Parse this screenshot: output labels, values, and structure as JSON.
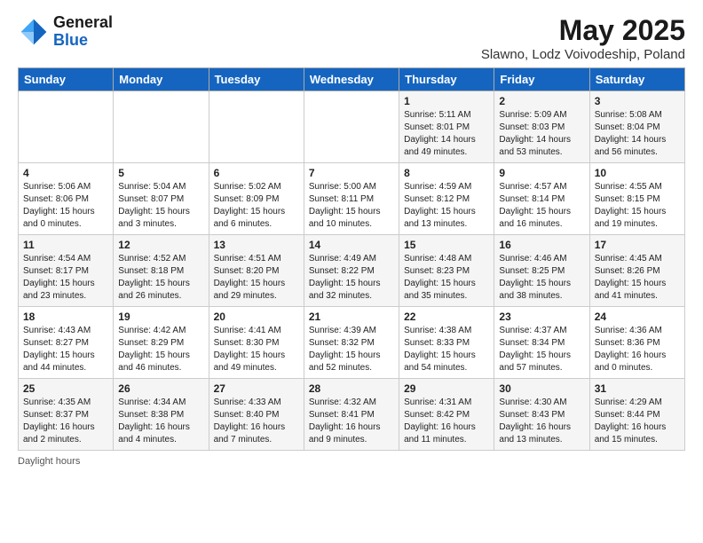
{
  "header": {
    "logo_general": "General",
    "logo_blue": "Blue",
    "title": "May 2025",
    "subtitle": "Slawno, Lodz Voivodeship, Poland"
  },
  "days_of_week": [
    "Sunday",
    "Monday",
    "Tuesday",
    "Wednesday",
    "Thursday",
    "Friday",
    "Saturday"
  ],
  "weeks": [
    [
      {
        "day": "",
        "info": ""
      },
      {
        "day": "",
        "info": ""
      },
      {
        "day": "",
        "info": ""
      },
      {
        "day": "",
        "info": ""
      },
      {
        "day": "1",
        "info": "Sunrise: 5:11 AM\nSunset: 8:01 PM\nDaylight: 14 hours\nand 49 minutes."
      },
      {
        "day": "2",
        "info": "Sunrise: 5:09 AM\nSunset: 8:03 PM\nDaylight: 14 hours\nand 53 minutes."
      },
      {
        "day": "3",
        "info": "Sunrise: 5:08 AM\nSunset: 8:04 PM\nDaylight: 14 hours\nand 56 minutes."
      }
    ],
    [
      {
        "day": "4",
        "info": "Sunrise: 5:06 AM\nSunset: 8:06 PM\nDaylight: 15 hours\nand 0 minutes."
      },
      {
        "day": "5",
        "info": "Sunrise: 5:04 AM\nSunset: 8:07 PM\nDaylight: 15 hours\nand 3 minutes."
      },
      {
        "day": "6",
        "info": "Sunrise: 5:02 AM\nSunset: 8:09 PM\nDaylight: 15 hours\nand 6 minutes."
      },
      {
        "day": "7",
        "info": "Sunrise: 5:00 AM\nSunset: 8:11 PM\nDaylight: 15 hours\nand 10 minutes."
      },
      {
        "day": "8",
        "info": "Sunrise: 4:59 AM\nSunset: 8:12 PM\nDaylight: 15 hours\nand 13 minutes."
      },
      {
        "day": "9",
        "info": "Sunrise: 4:57 AM\nSunset: 8:14 PM\nDaylight: 15 hours\nand 16 minutes."
      },
      {
        "day": "10",
        "info": "Sunrise: 4:55 AM\nSunset: 8:15 PM\nDaylight: 15 hours\nand 19 minutes."
      }
    ],
    [
      {
        "day": "11",
        "info": "Sunrise: 4:54 AM\nSunset: 8:17 PM\nDaylight: 15 hours\nand 23 minutes."
      },
      {
        "day": "12",
        "info": "Sunrise: 4:52 AM\nSunset: 8:18 PM\nDaylight: 15 hours\nand 26 minutes."
      },
      {
        "day": "13",
        "info": "Sunrise: 4:51 AM\nSunset: 8:20 PM\nDaylight: 15 hours\nand 29 minutes."
      },
      {
        "day": "14",
        "info": "Sunrise: 4:49 AM\nSunset: 8:22 PM\nDaylight: 15 hours\nand 32 minutes."
      },
      {
        "day": "15",
        "info": "Sunrise: 4:48 AM\nSunset: 8:23 PM\nDaylight: 15 hours\nand 35 minutes."
      },
      {
        "day": "16",
        "info": "Sunrise: 4:46 AM\nSunset: 8:25 PM\nDaylight: 15 hours\nand 38 minutes."
      },
      {
        "day": "17",
        "info": "Sunrise: 4:45 AM\nSunset: 8:26 PM\nDaylight: 15 hours\nand 41 minutes."
      }
    ],
    [
      {
        "day": "18",
        "info": "Sunrise: 4:43 AM\nSunset: 8:27 PM\nDaylight: 15 hours\nand 44 minutes."
      },
      {
        "day": "19",
        "info": "Sunrise: 4:42 AM\nSunset: 8:29 PM\nDaylight: 15 hours\nand 46 minutes."
      },
      {
        "day": "20",
        "info": "Sunrise: 4:41 AM\nSunset: 8:30 PM\nDaylight: 15 hours\nand 49 minutes."
      },
      {
        "day": "21",
        "info": "Sunrise: 4:39 AM\nSunset: 8:32 PM\nDaylight: 15 hours\nand 52 minutes."
      },
      {
        "day": "22",
        "info": "Sunrise: 4:38 AM\nSunset: 8:33 PM\nDaylight: 15 hours\nand 54 minutes."
      },
      {
        "day": "23",
        "info": "Sunrise: 4:37 AM\nSunset: 8:34 PM\nDaylight: 15 hours\nand 57 minutes."
      },
      {
        "day": "24",
        "info": "Sunrise: 4:36 AM\nSunset: 8:36 PM\nDaylight: 16 hours\nand 0 minutes."
      }
    ],
    [
      {
        "day": "25",
        "info": "Sunrise: 4:35 AM\nSunset: 8:37 PM\nDaylight: 16 hours\nand 2 minutes."
      },
      {
        "day": "26",
        "info": "Sunrise: 4:34 AM\nSunset: 8:38 PM\nDaylight: 16 hours\nand 4 minutes."
      },
      {
        "day": "27",
        "info": "Sunrise: 4:33 AM\nSunset: 8:40 PM\nDaylight: 16 hours\nand 7 minutes."
      },
      {
        "day": "28",
        "info": "Sunrise: 4:32 AM\nSunset: 8:41 PM\nDaylight: 16 hours\nand 9 minutes."
      },
      {
        "day": "29",
        "info": "Sunrise: 4:31 AM\nSunset: 8:42 PM\nDaylight: 16 hours\nand 11 minutes."
      },
      {
        "day": "30",
        "info": "Sunrise: 4:30 AM\nSunset: 8:43 PM\nDaylight: 16 hours\nand 13 minutes."
      },
      {
        "day": "31",
        "info": "Sunrise: 4:29 AM\nSunset: 8:44 PM\nDaylight: 16 hours\nand 15 minutes."
      }
    ]
  ],
  "footer": {
    "note": "Daylight hours"
  }
}
